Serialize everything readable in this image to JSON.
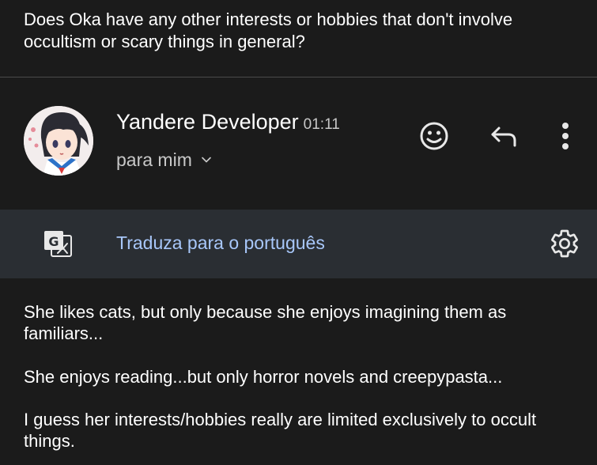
{
  "quoted_message": "Does Oka have any other interests or hobbies that don't involve occultism or scary things in general?",
  "email": {
    "sender": "Yandere Developer",
    "time": "01:11",
    "recipient": "para mim"
  },
  "translate": {
    "label": "Traduza para o português"
  },
  "body": {
    "paragraph_1": "She likes cats, but only because she enjoys imagining them as familiars...",
    "paragraph_2": "She enjoys reading...but only horror novels and creepypasta...",
    "paragraph_3": "I guess her interests/hobbies really are limited exclusively to occult things."
  },
  "icons": {
    "avatar": "anime-girl-avatar",
    "recipient_toggle": "chevron-down-icon",
    "emoji": "emoji-reaction-icon",
    "reply": "reply-icon",
    "more": "more-vert-icon",
    "translate": "translate-icon",
    "settings": "settings-gear-icon"
  },
  "colors": {
    "background": "#1b1b1b",
    "translate_bar": "#2a2e33",
    "link": "#a8c7fa",
    "secondary_text": "#c8c8c8"
  }
}
